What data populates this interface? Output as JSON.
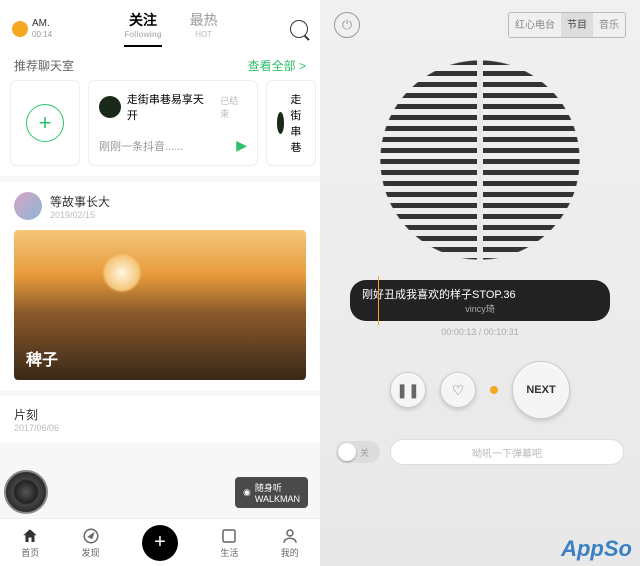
{
  "left": {
    "clock": {
      "ampm": "AM.",
      "time": "00:14"
    },
    "tabs": {
      "follow": "关注",
      "follow_sub": "Following",
      "hot": "最热",
      "hot_sub": "HOT"
    },
    "rec": {
      "title": "推荐聊天室",
      "seeall": "查看全部 >"
    },
    "rooms": {
      "r1_name": "走街串巷易享天开",
      "r1_ended": "已结束",
      "r1_sub": "刚刚一条抖音......",
      "r2_name": "走街串巷"
    },
    "post": {
      "author": "等故事长大",
      "date": "2019/02/15",
      "title": "稗子"
    },
    "post2": {
      "title": "片刻",
      "date": "2017/06/06"
    },
    "walkman": {
      "l1": "随身听",
      "l2": "WALKMAN"
    },
    "nav": {
      "home": "首页",
      "discover": "发现",
      "life": "生活",
      "mine": "我的"
    }
  },
  "right": {
    "seg": {
      "a": "红心电台",
      "b": "节目",
      "c": "音乐"
    },
    "track": {
      "title": "刚好丑成我喜欢的样子STOP.36",
      "artist": "vincy琦"
    },
    "time": {
      "cur": "00:00:13",
      "sep": " / ",
      "total": "00:10:31"
    },
    "next": "NEXT",
    "toggle_off": "关",
    "danmu_ph": "呦吼一下弹幕吧",
    "brand": "AppSo"
  }
}
